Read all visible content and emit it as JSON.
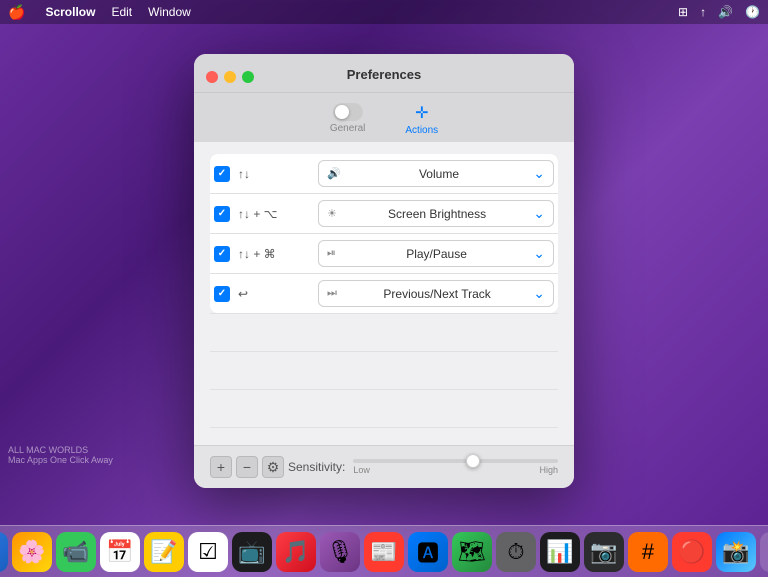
{
  "menubar": {
    "apple": "🍎",
    "app_name": "Scrollow",
    "menus": [
      "Edit",
      "Window"
    ],
    "right_icons": [
      "⊞",
      "↑",
      "🔊",
      "🕐"
    ]
  },
  "window": {
    "title": "Preferences",
    "tabs": [
      {
        "id": "general",
        "label": "General",
        "icon": "toggle",
        "active": false
      },
      {
        "id": "actions",
        "label": "Actions",
        "icon": "✛",
        "active": true
      }
    ],
    "actions": [
      {
        "id": "row1",
        "checked": true,
        "gesture": "↑↓",
        "action_icon": "🔊",
        "action_label": "Volume",
        "shortcut": ""
      },
      {
        "id": "row2",
        "checked": true,
        "gesture": "↑↓ + ⌥",
        "action_icon": "☀",
        "action_label": "Screen Brightness",
        "shortcut": ""
      },
      {
        "id": "row3",
        "checked": true,
        "gesture": "↑↓ + ⌘",
        "action_icon": "⏯",
        "action_label": "Play/Pause",
        "shortcut": ""
      },
      {
        "id": "row4",
        "checked": true,
        "gesture": "↩",
        "action_icon": "⏭",
        "action_label": "Previous/Next Track",
        "shortcut": ""
      }
    ],
    "bottom_toolbar": {
      "add_label": "+",
      "remove_label": "−",
      "settings_label": "⚙",
      "sensitivity_label": "Sensitivity:",
      "slider_low": "Low",
      "slider_high": "High"
    }
  },
  "dock": {
    "items": [
      {
        "id": "finder",
        "icon": "🖥",
        "color": "#1a6fe6"
      },
      {
        "id": "photos",
        "icon": "🌸",
        "color": "#ff9500"
      },
      {
        "id": "facetime",
        "icon": "📹",
        "color": "#34c759"
      },
      {
        "id": "calendar",
        "icon": "📅",
        "color": "#ff3b30"
      },
      {
        "id": "notes",
        "icon": "📝",
        "color": "#ffcc00"
      },
      {
        "id": "reminders",
        "icon": "📋",
        "color": "#ff3b30"
      },
      {
        "id": "appletv",
        "icon": "📺",
        "color": "#333"
      },
      {
        "id": "music",
        "icon": "🎵",
        "color": "#fc3c44"
      },
      {
        "id": "podcasts",
        "icon": "🎙",
        "color": "#9b59b6"
      },
      {
        "id": "news",
        "icon": "📰",
        "color": "#ff3b30"
      },
      {
        "id": "appstore",
        "icon": "🅰",
        "color": "#007aff"
      },
      {
        "id": "maps",
        "icon": "🗺",
        "color": "#34c759"
      },
      {
        "id": "screentime",
        "icon": "⏱",
        "color": "#555"
      },
      {
        "id": "istatmenus",
        "icon": "📊",
        "color": "#444"
      },
      {
        "id": "screenium",
        "icon": "📷",
        "color": "#333"
      },
      {
        "id": "hackr",
        "icon": "#️⃣",
        "color": "#555"
      },
      {
        "id": "tpro",
        "icon": "🔴",
        "color": "#ff3b30"
      },
      {
        "id": "camera",
        "icon": "📸",
        "color": "#007aff"
      },
      {
        "id": "trash",
        "icon": "🗑",
        "color": "#888"
      }
    ]
  },
  "watermark": {
    "line1": "ALL MAC WORLDS",
    "line2": "Mac Apps One Click Away"
  }
}
